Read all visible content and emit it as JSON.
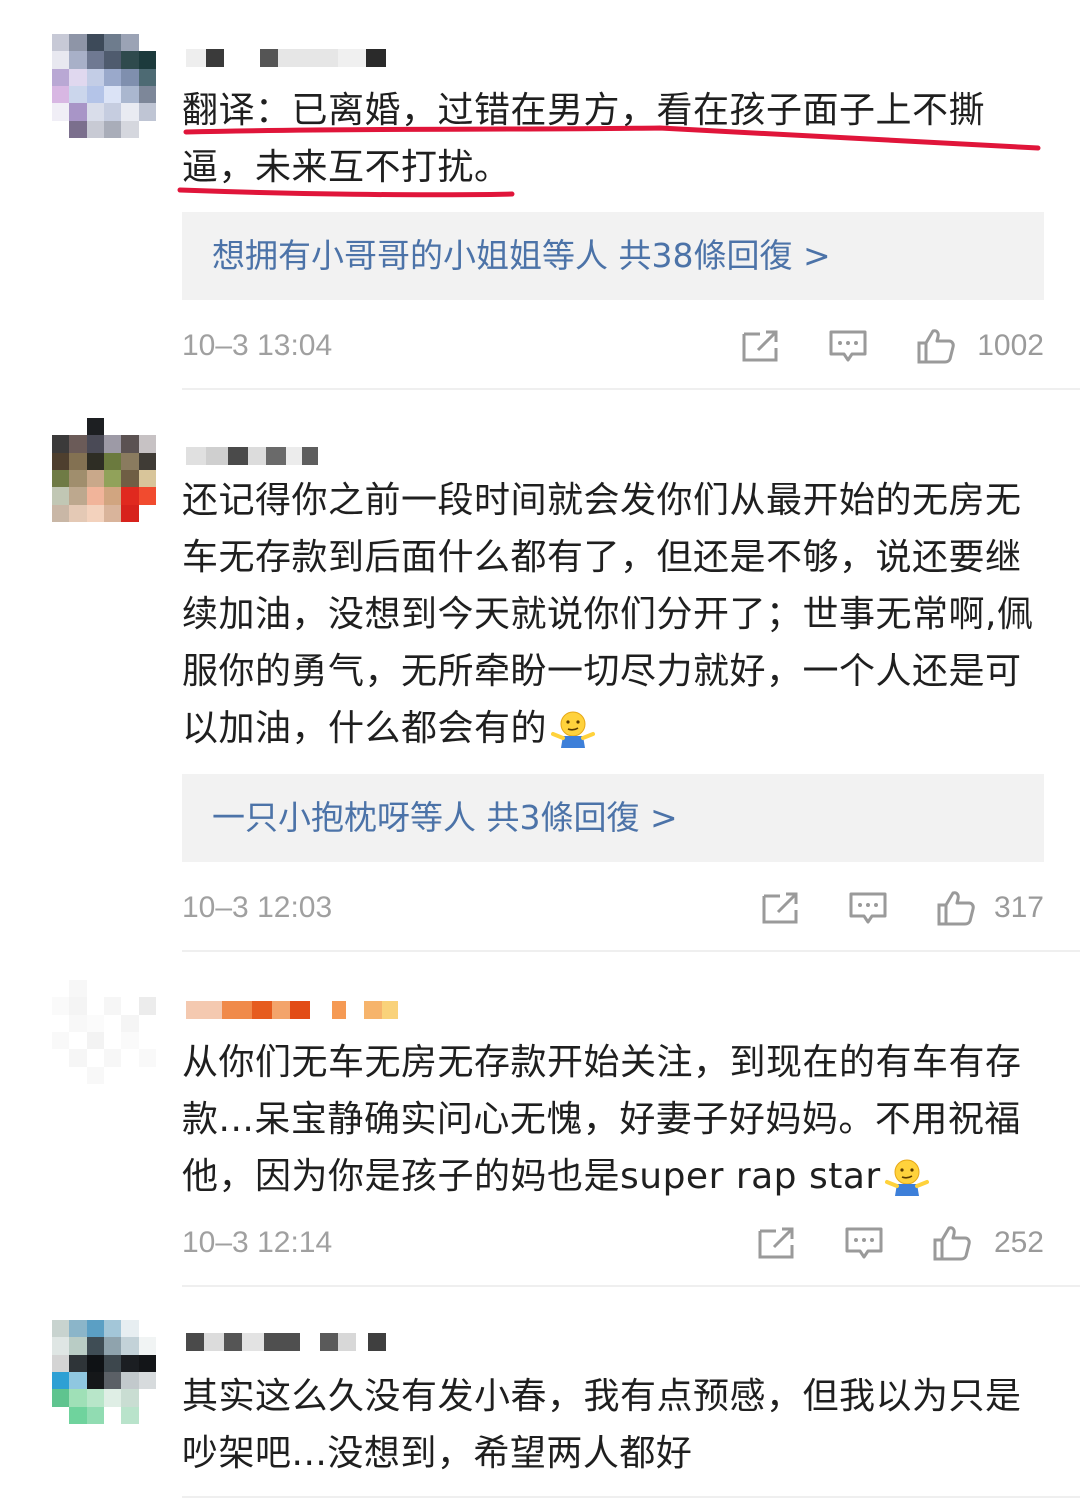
{
  "comments": [
    {
      "text": "翻译：已离婚，过错在男方，看在孩子面子上不撕逼，未来互不打扰。",
      "replies": {
        "names": "想拥有小哥哥的小姐姐",
        "others": "等人",
        "count": "共38條回復 >"
      },
      "time": "10–3 13:04",
      "likes": "1002"
    },
    {
      "text": "还记得你之前一段时间就会发你们从最开始的无房无车无存款到后面什么都有了，但还是不够，说还要继续加油，没想到今天就说你们分开了；世事无常啊,佩服你的勇气，无所牵盼一切尽力就好，一个人还是可以加油，什么都会有的",
      "replies": {
        "names": "一只小抱枕呀",
        "others": "等人",
        "count": "共3條回復 >"
      },
      "time": "10–3 12:03",
      "likes": "317"
    },
    {
      "text": "从你们无车无房无存款开始关注，到现在的有车有存款...呆宝静确实问心无愧，好妻子好妈妈。不用祝福他，因为你是孩子的妈也是super rap star",
      "time": "10–3 12:14",
      "likes": "252"
    },
    {
      "text": "其实这么久没有发小春，我有点预感，但我以为只是吵架吧...没想到，希望两人都好"
    }
  ],
  "icons": {
    "share": "share-icon",
    "comment": "comment-icon",
    "like": "thumbs-up-icon",
    "emoji": "shrug-emoji-icon"
  },
  "colors": {
    "reply_link": "#4c73a8",
    "meta_text": "#a0a0a0",
    "reply_bg": "#f2f2f2",
    "underline": "#e0153a"
  }
}
